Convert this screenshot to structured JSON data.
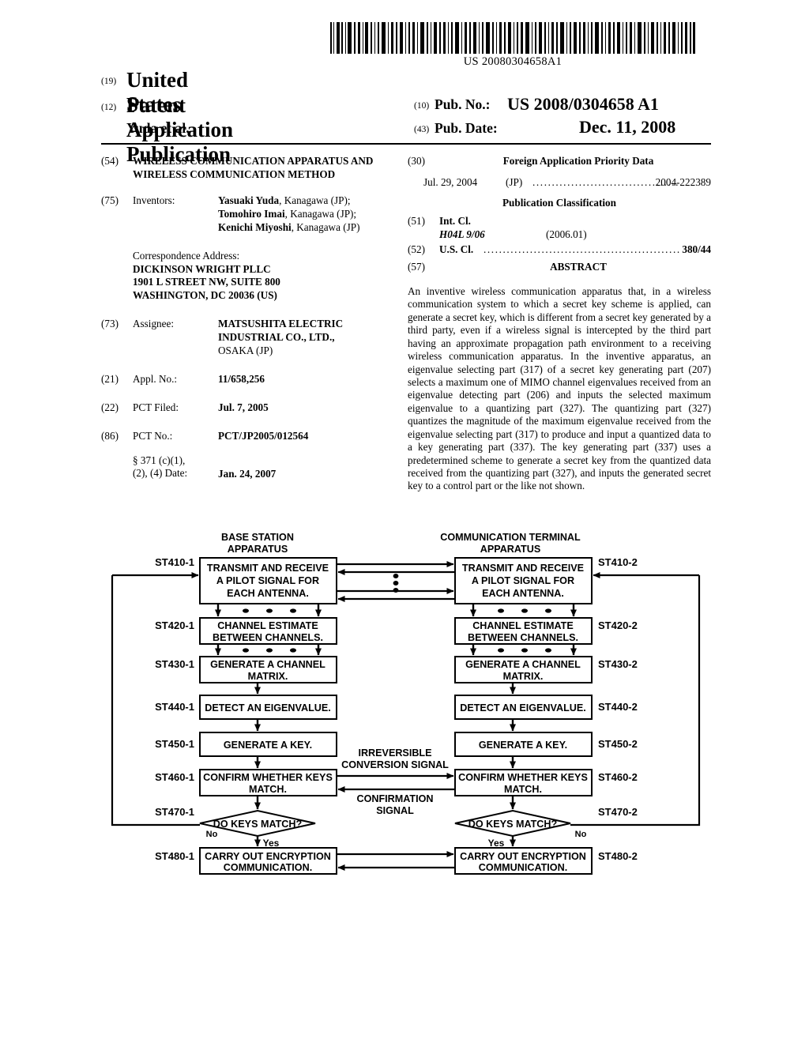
{
  "header": {
    "barcode_number": "US 20080304658A1",
    "country_code": "(19)",
    "country": "United States",
    "doctype_code": "(12)",
    "doctype": "Patent Application Publication",
    "author": "Yuda et al.",
    "pubno_code": "(10)",
    "pubno_label": "Pub. No.:",
    "pubno_value": "US 2008/0304658 A1",
    "pubdate_code": "(43)",
    "pubdate_label": "Pub. Date:",
    "pubdate_value": "Dec. 11, 2008"
  },
  "left": {
    "title_code": "(54)",
    "title": "WIRELESS COMMUNICATION APPARATUS AND WIRELESS COMMUNICATION METHOD",
    "inventors_code": "(75)",
    "inventors_label": "Inventors:",
    "inventors": [
      {
        "name": "Yasuaki Yuda",
        "rest": ", Kanagawa (JP);"
      },
      {
        "name": "Tomohiro Imai",
        "rest": ", Kanagawa (JP);"
      },
      {
        "name": "Kenichi Miyoshi",
        "rest": ", Kanagawa (JP)"
      }
    ],
    "correspondence_label": "Correspondence Address:",
    "correspondence": [
      "DICKINSON WRIGHT PLLC",
      "1901 L STREET NW, SUITE 800",
      "WASHINGTON, DC 20036 (US)"
    ],
    "assignee_code": "(73)",
    "assignee_label": "Assignee:",
    "assignee_lines_bold": [
      "MATSUSHITA ELECTRIC",
      "INDUSTRIAL CO., LTD.,"
    ],
    "assignee_line_plain": "OSAKA (JP)",
    "applno_code": "(21)",
    "applno_label": "Appl. No.:",
    "applno_value": "11/658,256",
    "pctfiled_code": "(22)",
    "pctfiled_label": "PCT Filed:",
    "pctfiled_value": "Jul. 7, 2005",
    "pctno_code": "(86)",
    "pctno_label": "PCT No.:",
    "pctno_value": "PCT/JP2005/012564",
    "s371_line1": "§ 371 (c)(1),",
    "s371_line2": "(2), (4) Date:",
    "s371_value": "Jan. 24, 2007"
  },
  "right": {
    "foreign_code": "(30)",
    "foreign_heading": "Foreign Application Priority Data",
    "priority_date": "Jul. 29, 2004",
    "priority_country": "(JP)",
    "priority_number": "2004-222389",
    "classification_heading": "Publication Classification",
    "intcl_code": "(51)",
    "intcl_label": "Int. Cl.",
    "intcl_value": "H04L 9/06",
    "intcl_version": "(2006.01)",
    "uscl_code": "(52)",
    "uscl_label": "U.S. Cl.",
    "uscl_value": "380/44",
    "abstract_code": "(57)",
    "abstract_heading": "ABSTRACT",
    "abstract_text": "An inventive wireless communication apparatus that, in a wireless communication system to which a secret key scheme is applied, can generate a secret key, which is different from a secret key generated by a third party, even if a wireless signal is intercepted by the third part having an approximate propagation path environment to a receiving wireless communication apparatus. In the inventive apparatus, an eigenvalue selecting part (317) of a secret key generating part (207) selects a maximum one of MIMO channel eigenvalues received from an eigenvalue detecting part (206) and inputs the selected maximum eigenvalue to a quantizing part (327). The quantizing part (327) quantizes the magnitude of the maximum eigenvalue received from the eigenvalue selecting part (317) to produce and input a quantized data to a key generating part (337). The key generating part (337) uses a predetermined scheme to generate a secret key from the quantized data received from the quantizing part (327), and inputs the generated secret key to a control part or the like not shown."
  },
  "figure": {
    "left_column_title_line1": "BASE STATION",
    "left_column_title_line2": "APPARATUS",
    "right_column_title_line1": "COMMUNICATION TERMINAL",
    "right_column_title_line2": "APPARATUS",
    "steps_left": [
      {
        "tag": "ST410-1",
        "text": "TRANSMIT AND RECEIVE A PILOT SIGNAL FOR EACH ANTENNA."
      },
      {
        "tag": "ST420-1",
        "text": "CHANNEL ESTIMATE BETWEEN CHANNELS."
      },
      {
        "tag": "ST430-1",
        "text": "GENERATE A CHANNEL MATRIX."
      },
      {
        "tag": "ST440-1",
        "text": "DETECT AN EIGENVALUE."
      },
      {
        "tag": "ST450-1",
        "text": "GENERATE A KEY."
      },
      {
        "tag": "ST460-1",
        "text": "CONFIRM WHETHER KEYS MATCH."
      },
      {
        "tag": "ST470-1",
        "text": "DO KEYS MATCH?"
      },
      {
        "tag": "ST480-1",
        "text": "CARRY OUT ENCRYPTION COMMUNICATION."
      }
    ],
    "steps_right": [
      {
        "tag": "ST410-2",
        "text": "TRANSMIT AND RECEIVE A PILOT SIGNAL FOR EACH ANTENNA."
      },
      {
        "tag": "ST420-2",
        "text": "CHANNEL ESTIMATE BETWEEN CHANNELS."
      },
      {
        "tag": "ST430-2",
        "text": "GENERATE A CHANNEL MATRIX."
      },
      {
        "tag": "ST440-2",
        "text": "DETECT AN EIGENVALUE."
      },
      {
        "tag": "ST450-2",
        "text": "GENERATE A KEY."
      },
      {
        "tag": "ST460-2",
        "text": "CONFIRM WHETHER KEYS MATCH."
      },
      {
        "tag": "ST470-2",
        "text": "DO KEYS MATCH?"
      },
      {
        "tag": "ST480-2",
        "text": "CARRY OUT ENCRYPTION COMMUNICATION."
      }
    ],
    "signal_label_1_line1": "IRREVERSIBLE",
    "signal_label_1_line2": "CONVERSION SIGNAL",
    "signal_label_2_line1": "CONFIRMATION",
    "signal_label_2_line2": "SIGNAL",
    "branch_no": "No",
    "branch_yes": "Yes"
  }
}
